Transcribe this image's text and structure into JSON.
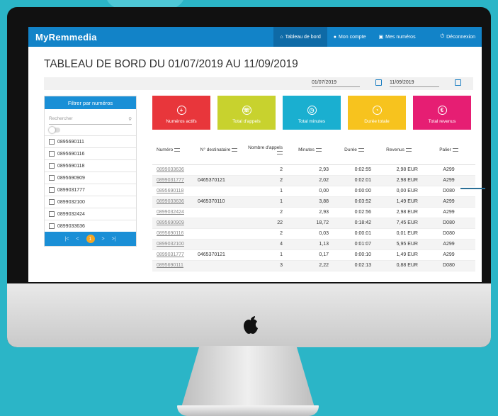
{
  "app": {
    "logo_pre": "My",
    "logo_bold": "Rem",
    "logo_post": "media",
    "nav": [
      {
        "label": "Tableau de bord",
        "icon": "home-icon",
        "active": true
      },
      {
        "label": "Mon compte",
        "icon": "user-icon"
      },
      {
        "label": "Mes numéros",
        "icon": "phone-book-icon"
      },
      {
        "label": "Déconnexion",
        "icon": "power-icon"
      }
    ]
  },
  "page": {
    "title": "TABLEAU DE BORD DU 01/07/2019 AU 11/09/2019",
    "date_from": "01/07/2019",
    "date_to": "11/09/2019"
  },
  "filter": {
    "header": "Filtrer par numéros",
    "search_placeholder": "Rechercher",
    "numbers": [
      "0895690111",
      "0895690116",
      "0895690118",
      "0895690909",
      "0899031777",
      "0899032100",
      "0899032424",
      "0899033636"
    ],
    "pager": {
      "first": "|<",
      "prev": "<",
      "current": "1",
      "next": ">",
      "last": ">|"
    }
  },
  "tiles": [
    {
      "label": "Numéros actifs",
      "icon": "phone-plus-icon",
      "symbol": "+",
      "color": "#e8363b"
    },
    {
      "label": "Total d'appels",
      "icon": "phone-icon",
      "symbol": "☏",
      "color": "#c8d22e"
    },
    {
      "label": "Total minutes",
      "icon": "timer-icon",
      "symbol": "◷",
      "color": "#1aafd0"
    },
    {
      "label": "Durée totale",
      "icon": "clock-icon",
      "symbol": "◔",
      "color": "#f7c31e"
    },
    {
      "label": "Total revenus",
      "icon": "euro-icon",
      "symbol": "€",
      "color": "#e61e73"
    }
  ],
  "table": {
    "headers": [
      "Numéro",
      "N° destinataire",
      "Nombre d'appels",
      "Minutes",
      "Durée",
      "Revenus",
      "Palier"
    ],
    "rows": [
      [
        "0899033636",
        "",
        "2",
        "2,93",
        "0:02:55",
        "2,98 EUR",
        "A299"
      ],
      [
        "0899031777",
        "0465370121",
        "2",
        "2,02",
        "0:02:01",
        "2,98 EUR",
        "A299"
      ],
      [
        "0895690118",
        "",
        "1",
        "0,00",
        "0:00:00",
        "0,00 EUR",
        "D080"
      ],
      [
        "0899033636",
        "0465370110",
        "1",
        "3,88",
        "0:03:52",
        "1,49 EUR",
        "A299"
      ],
      [
        "0899032424",
        "",
        "2",
        "2,93",
        "0:02:56",
        "2,98 EUR",
        "A299"
      ],
      [
        "0895690909",
        "",
        "22",
        "18,72",
        "0:18:42",
        "7,45 EUR",
        "D080"
      ],
      [
        "0895690116",
        "",
        "2",
        "0,03",
        "0:00:01",
        "0,01 EUR",
        "D080"
      ],
      [
        "0899032100",
        "",
        "4",
        "1,13",
        "0:01:07",
        "5,95 EUR",
        "A299"
      ],
      [
        "0899031777",
        "0465370121",
        "1",
        "0,17",
        "0:00:10",
        "1,49 EUR",
        "A299"
      ],
      [
        "0895690111",
        "",
        "3",
        "2,22",
        "0:02:13",
        "0,88 EUR",
        "D080"
      ]
    ]
  }
}
